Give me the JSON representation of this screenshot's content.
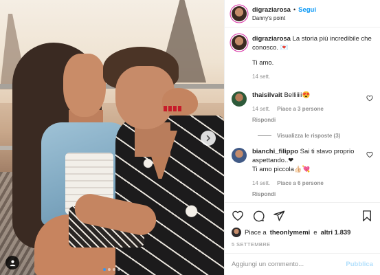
{
  "post": {
    "username": "digraziarosa",
    "separator": "•",
    "follow_label": "Segui",
    "location": "Danny's point",
    "photo_alt": "couple photo",
    "carousel": {
      "count": 4,
      "active": 1
    }
  },
  "caption": {
    "username": "digraziarosa",
    "text_line1": "La storia più incredibile che conosco. 💌",
    "text_line2": "Ti amo.",
    "time": "14 sett."
  },
  "comments": [
    {
      "username": "thaisilvait",
      "text": "Belliiiii😍",
      "time": "14 sett.",
      "likes": "Piace a 3 persone",
      "reply": "Rispondi",
      "view_replies": "Visualizza le risposte (3)"
    },
    {
      "username": "bianchi_filippo",
      "text": "Sai ti stavo proprio aspettando..❤",
      "text_line2": "Ti amo piccola👍🏻💘",
      "time": "14 sett.",
      "likes": "Piace a 6 persone",
      "reply": "Rispondi"
    }
  ],
  "likes": {
    "prefix": "Piace a",
    "user": "theonlymemi",
    "and": "e",
    "others": "altri 1.839"
  },
  "date": "5 SETTEMBRE",
  "add_comment": {
    "placeholder": "Aggiungi un commento...",
    "publish_label": "Pubblica"
  },
  "colors": {
    "link_blue": "#0095f6",
    "publish_disabled": "#b2dffc",
    "muted": "#8e8e8e",
    "text": "#262626"
  }
}
